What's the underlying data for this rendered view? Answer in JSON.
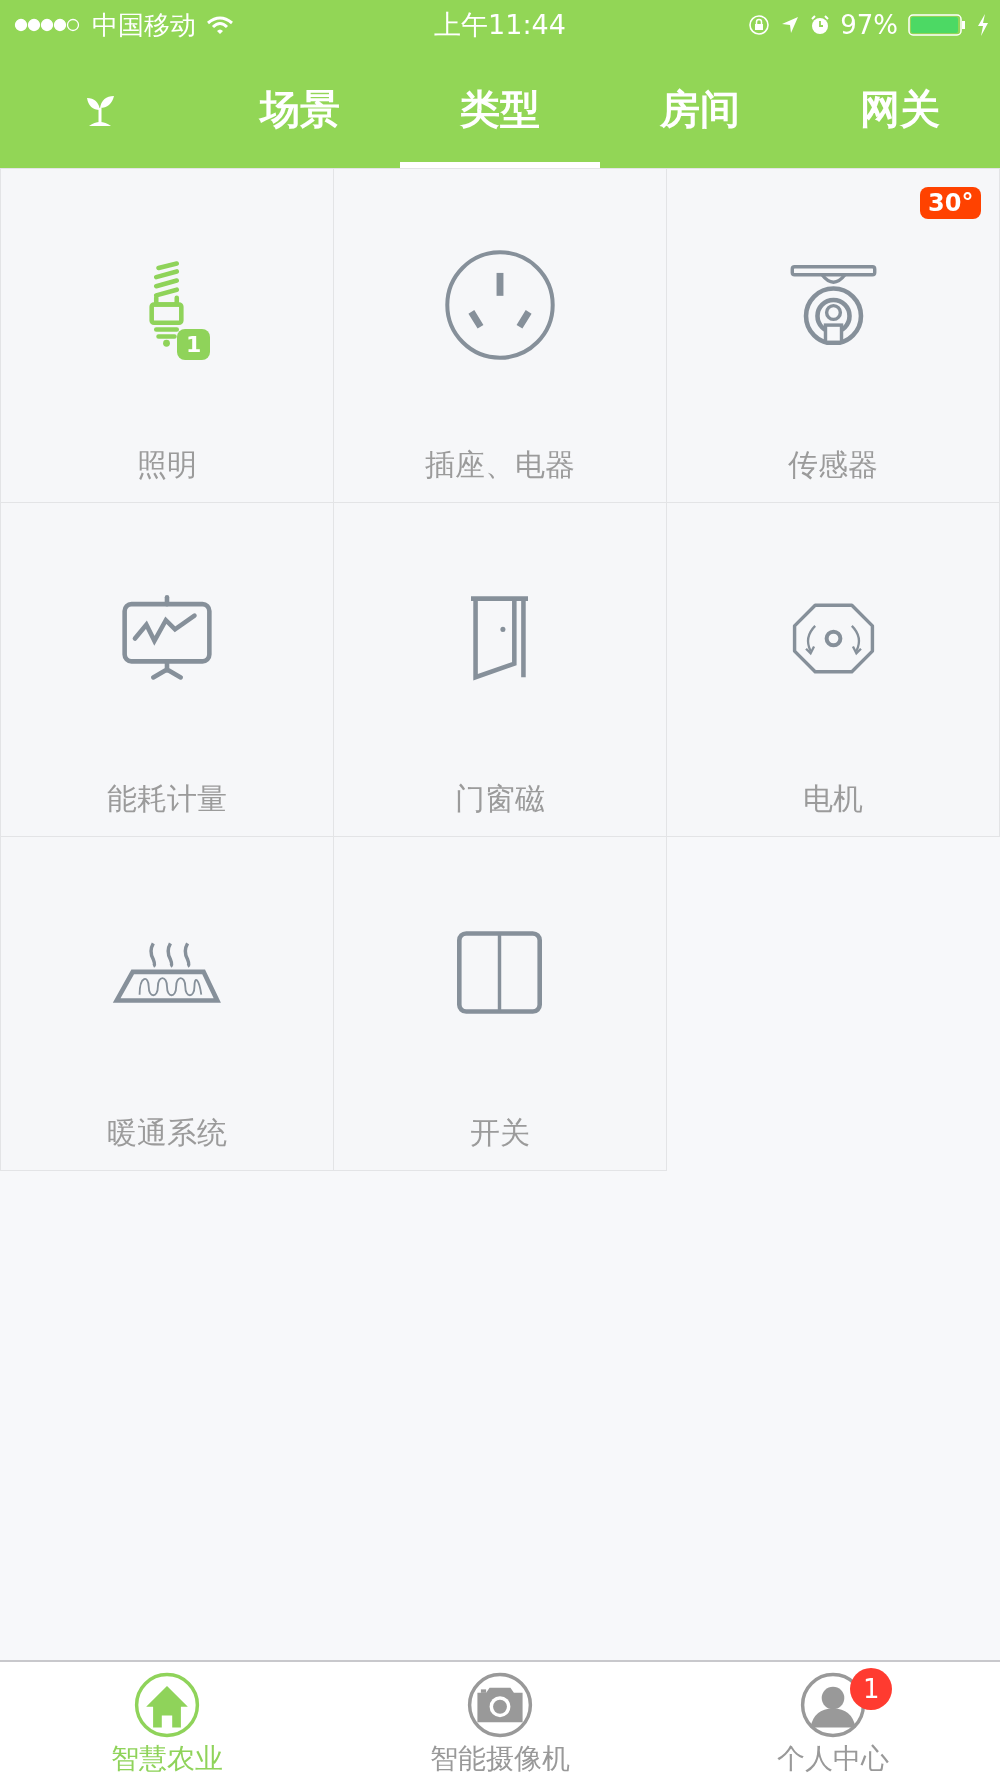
{
  "status_bar": {
    "carrier": "中国移动",
    "time": "上午11:44",
    "battery": "97%"
  },
  "tabs": [
    {
      "kind": "icon",
      "selected": false
    },
    {
      "kind": "text",
      "label": "场景",
      "selected": false
    },
    {
      "kind": "text",
      "label": "类型",
      "selected": true
    },
    {
      "kind": "text",
      "label": "房间",
      "selected": false
    },
    {
      "kind": "text",
      "label": "网关",
      "selected": false
    }
  ],
  "categories": [
    {
      "label": "照明",
      "kind": "bulb",
      "active": true,
      "badge": {
        "text": "1",
        "kind": "count"
      }
    },
    {
      "label": "插座、电器",
      "kind": "socket",
      "active": false
    },
    {
      "label": "传感器",
      "kind": "sensor",
      "active": false,
      "badge": {
        "text": "30°",
        "kind": "alert"
      }
    },
    {
      "label": "能耗计量",
      "kind": "meter",
      "active": false
    },
    {
      "label": "门窗磁",
      "kind": "door",
      "active": false
    },
    {
      "label": "电机",
      "kind": "motor",
      "active": false
    },
    {
      "label": "暖通系统",
      "kind": "heater",
      "active": false
    },
    {
      "label": "开关",
      "kind": "switch",
      "active": false
    }
  ],
  "bottom_nav": [
    {
      "label": "智慧农业",
      "kind": "home",
      "selected": true
    },
    {
      "label": "智能摄像机",
      "kind": "camera",
      "selected": false
    },
    {
      "label": "个人中心",
      "kind": "person",
      "selected": false,
      "badge": "1"
    }
  ]
}
